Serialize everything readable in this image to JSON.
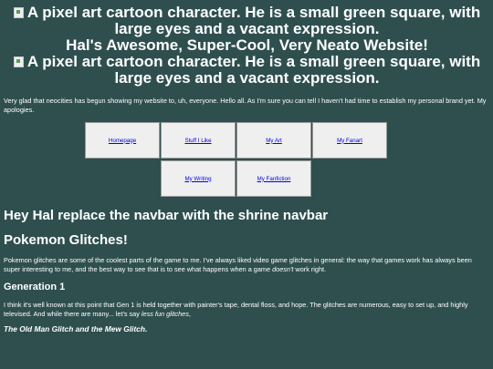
{
  "header": {
    "image_alt_1": "A pixel art cartoon character. He is a small green square, with large eyes and a vacant expression.",
    "site_title": "Hal's Awesome, Super-Cool, Very Neato Website!",
    "image_alt_2": "A pixel art cartoon character. He is a small green square, with large eyes and a vacant expression."
  },
  "intro": {
    "text": "Very glad that neocities has begun showing my website to, uh, everyone. Hello all. As I'm sure you can tell I haven't had time to establish my personal brand yet. My apologies."
  },
  "nav": {
    "items": [
      {
        "label": "Homepage"
      },
      {
        "label": "Stuff I Like"
      },
      {
        "label": "My Art"
      },
      {
        "label": "My Fanart"
      },
      {
        "label": "My Writing"
      },
      {
        "label": "My Fanfiction"
      }
    ]
  },
  "main": {
    "hal_note": "Hey Hal replace the navbar with the shrine navbar",
    "glitch_title": "Pokemon Glitches!",
    "para1_start": "Pokemon glitches are some of the coolest parts of the game to me. I've always liked video game glitches in general: the way that games work has always been super interesting to me, and the best way to see that is to see what happens when a game ",
    "para1_em": "doesn't",
    "para1_end": " work right.",
    "gen_title": "Generation 1",
    "para2_start": "I think it's well known at this point that Gen 1 is held together with painter's tape, dental floss, and hope. The glitches are numerous, easy to set up, and highly televised. And while there are many... let's say ",
    "para2_em": "less fun glitches",
    "para2_end": ",",
    "glitch_sub": "The Old Man Glitch and the Mew Glitch."
  }
}
